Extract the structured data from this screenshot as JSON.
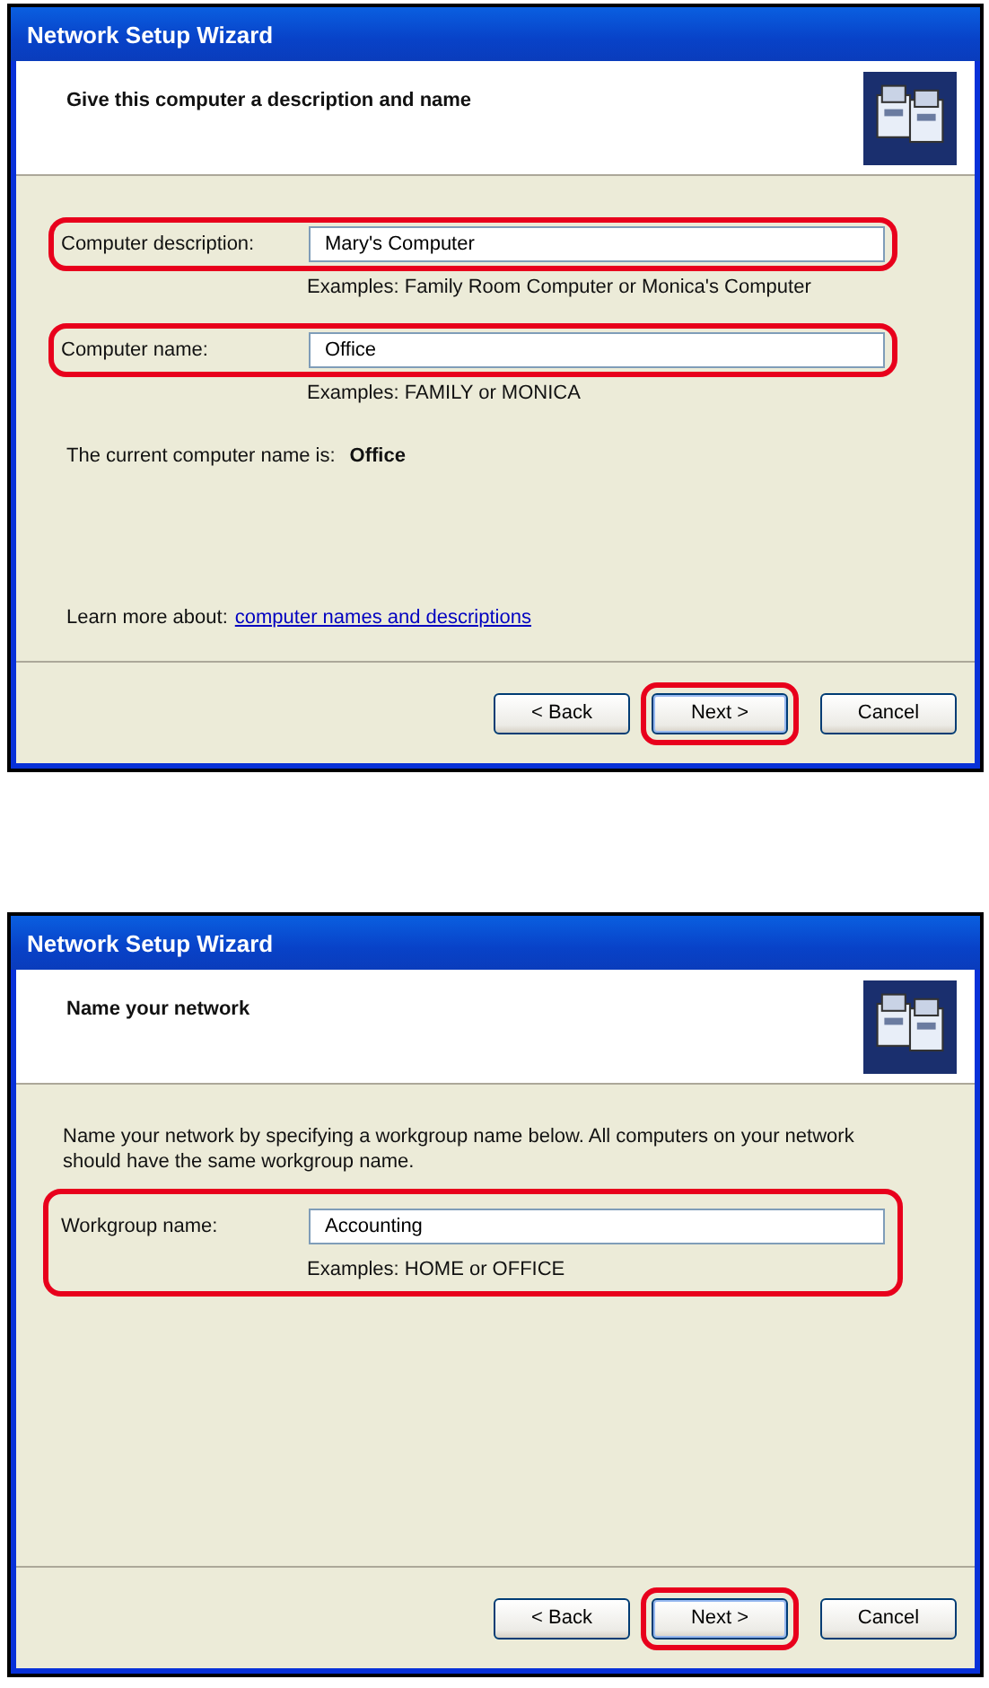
{
  "dialogs": [
    {
      "title": "Network Setup Wizard",
      "heading": "Give this computer a description and name",
      "fields": [
        {
          "label": "Computer description:",
          "value": "Mary's Computer",
          "example": "Examples: Family Room Computer or Monica's Computer",
          "highlighted": true,
          "highlight_covers_example": false
        },
        {
          "label": "Computer name:",
          "value": "Office",
          "example": "Examples: FAMILY or MONICA",
          "highlighted": true,
          "highlight_covers_example": false
        }
      ],
      "current": {
        "label": "The current computer name is:",
        "value": "Office"
      },
      "learn_more": {
        "label": "Learn more about:",
        "link": "computer names and descriptions"
      },
      "buttons": [
        {
          "label": "< Back",
          "highlighted": false
        },
        {
          "label": "Next >",
          "highlighted": true
        },
        {
          "label": "Cancel",
          "highlighted": false
        }
      ]
    },
    {
      "title": "Network Setup Wizard",
      "heading": "Name your network",
      "intro": "Name your network by specifying a workgroup name below. All computers on your network should have the same workgroup name.",
      "fields": [
        {
          "label": "Workgroup name:",
          "value": "Accounting",
          "example": "Examples: HOME or OFFICE",
          "highlighted": true,
          "highlight_covers_example": true
        }
      ],
      "buttons": [
        {
          "label": "< Back",
          "highlighted": false
        },
        {
          "label": "Next >",
          "highlighted": true
        },
        {
          "label": "Cancel",
          "highlighted": false
        }
      ]
    }
  ]
}
